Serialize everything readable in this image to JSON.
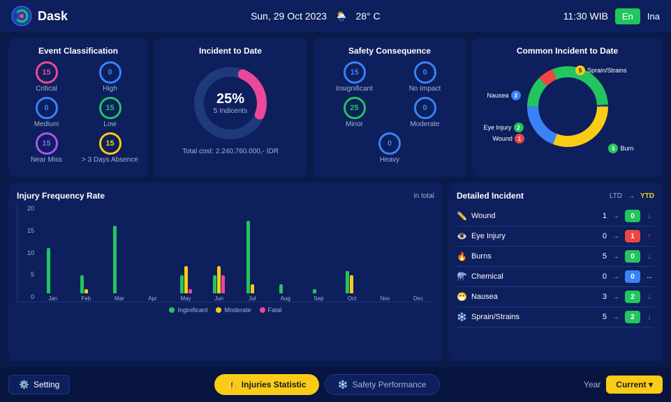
{
  "header": {
    "logo": "Dask",
    "date": "Sun, 29 Oct 2023",
    "weather": "28° C",
    "time": "11:30 WIB",
    "lang_en": "En",
    "lang_ina": "Ina"
  },
  "event_classification": {
    "title": "Event Classification",
    "items": [
      {
        "label": "Critical",
        "value": "15",
        "color": "#ec4899"
      },
      {
        "label": "High",
        "value": "0",
        "color": "#3b82f6"
      },
      {
        "label": "Medium",
        "value": "0",
        "color": "#3b82f6"
      },
      {
        "label": "Low",
        "value": "15",
        "color": "#22c55e"
      },
      {
        "label": "Near Miss",
        "value": "15",
        "color": "#a855f7"
      },
      {
        "label": "> 3 Days Absence",
        "value": "15",
        "color": "#facc15"
      }
    ]
  },
  "incident_to_date": {
    "title": "Incident to Date",
    "percent": "25%",
    "incidents": "5 Indicents",
    "total_cost": "Total cost: 2.240.760.000,- IDR"
  },
  "safety_consequence": {
    "title": "Safety Consequence",
    "items": [
      {
        "label": "Insignificant",
        "value": "15",
        "color": "#3b82f6"
      },
      {
        "label": "No Impact",
        "value": "0",
        "color": "#3b82f6"
      },
      {
        "label": "Minor",
        "value": "25",
        "color": "#22c55e"
      },
      {
        "label": "Moderate",
        "value": "0",
        "color": "#3b82f6"
      },
      {
        "label": "Heavy",
        "value": "0",
        "color": "#3b82f6"
      }
    ]
  },
  "common_incident": {
    "title": "Common Incident to Date",
    "items": [
      {
        "label": "Sprain/Strains",
        "value": "5",
        "color": "#facc15"
      },
      {
        "label": "Nausea",
        "value": "3",
        "color": "#3b82f6"
      },
      {
        "label": "Eye Injury",
        "value": "2",
        "color": "#22c55e"
      },
      {
        "label": "Wound",
        "value": "1",
        "color": "#ef4444"
      },
      {
        "label": "Burn",
        "value": "5",
        "color": "#22c55e"
      }
    ]
  },
  "injury_freq": {
    "title": "Injury Frequency Rate",
    "subtitle": "in total",
    "y_labels": [
      "0",
      "5",
      "10",
      "15",
      "20"
    ],
    "months": [
      "Jan",
      "Feb",
      "Mar",
      "Apr",
      "May",
      "Jun",
      "Jul",
      "Aug",
      "Sep",
      "Oct",
      "Nov",
      "Dec"
    ],
    "data": {
      "insignificant": [
        10,
        4,
        15,
        0,
        4,
        4,
        16,
        2,
        1,
        5,
        0,
        0
      ],
      "moderate": [
        0,
        1,
        0,
        0,
        6,
        6,
        2,
        0,
        0,
        4,
        0,
        0
      ],
      "fatal": [
        0,
        0,
        0,
        0,
        1,
        4,
        0,
        0,
        0,
        0,
        0,
        0
      ]
    },
    "legend": [
      {
        "label": "Inginificant",
        "color": "#22c55e"
      },
      {
        "label": "Moderate",
        "color": "#facc15"
      },
      {
        "label": "Fatal",
        "color": "#ec4899"
      }
    ]
  },
  "detailed_incident": {
    "title": "Detailed Incident",
    "col_ltd": "LTD",
    "col_ytd": "YTD",
    "rows": [
      {
        "name": "Wound",
        "icon": "✏️",
        "ltd": "1",
        "ytd": "0",
        "ytd_color": "#22c55e",
        "trend": "↓",
        "trend_class": "trend-down"
      },
      {
        "name": "Eye Injury",
        "icon": "👁️",
        "ltd": "0",
        "ytd": "1",
        "ytd_color": "#ef4444",
        "trend": "↑",
        "trend_class": "trend-up"
      },
      {
        "name": "Burns",
        "icon": "🔥",
        "ltd": "5",
        "ytd": "0",
        "ytd_color": "#22c55e",
        "trend": "↓",
        "trend_class": "trend-down"
      },
      {
        "name": "Chemical",
        "icon": "⚗️",
        "ltd": "0",
        "ytd": "0",
        "ytd_color": "#3b82f6",
        "trend": "↔",
        "trend_class": "trend-side"
      },
      {
        "name": "Nausea",
        "icon": "😷",
        "ltd": "3",
        "ytd": "2",
        "ytd_color": "#22c55e",
        "trend": "↓",
        "trend_class": "trend-down"
      },
      {
        "name": "Sprain/Strains",
        "icon": "❄️",
        "ltd": "5",
        "ytd": "2",
        "ytd_color": "#22c55e",
        "trend": "↓",
        "trend_class": "trend-down"
      }
    ]
  },
  "footer": {
    "setting_label": "Setting",
    "injuries_label": "Injuries Statistic",
    "safety_label": "Safety Performance",
    "year_label": "Year",
    "year_value": "Current ▾"
  }
}
